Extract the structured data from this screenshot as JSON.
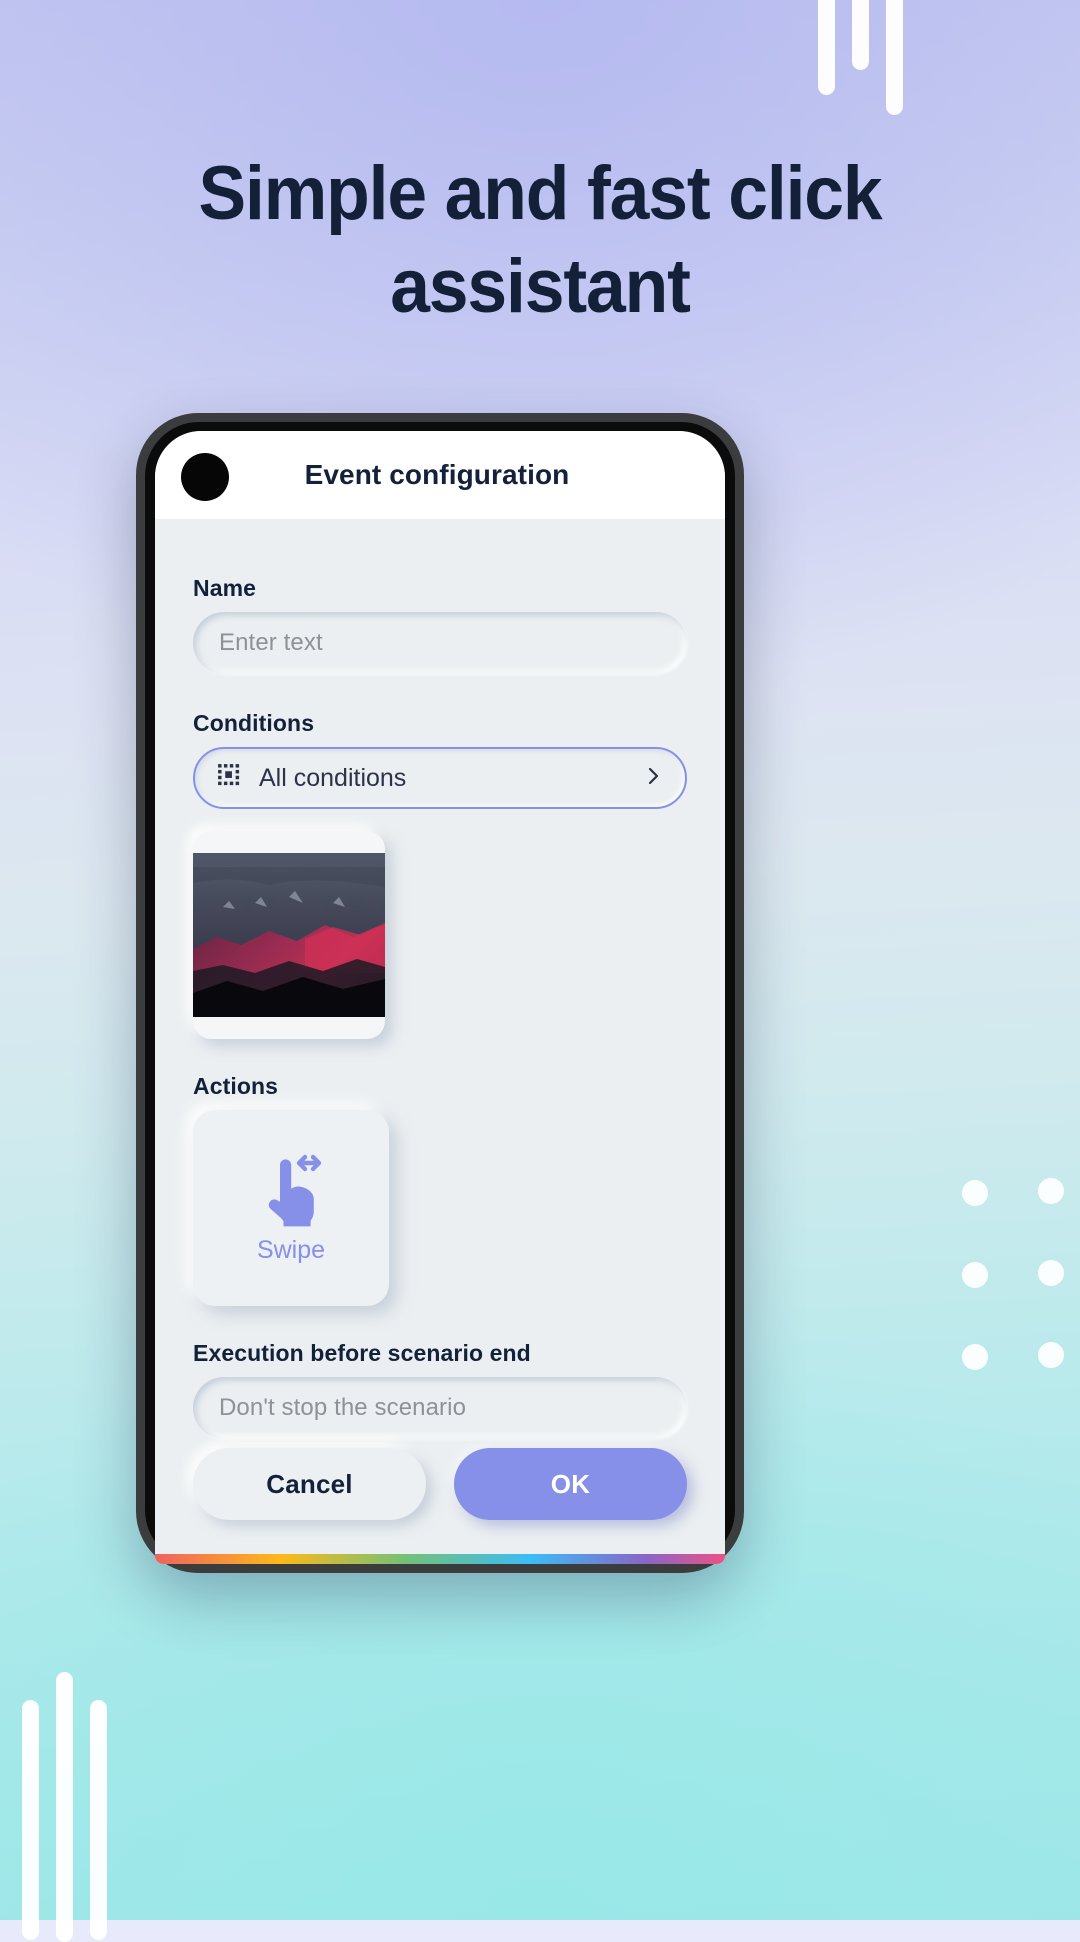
{
  "headline": {
    "line1": "Simple and fast click",
    "line2": "assistant"
  },
  "colors": {
    "accent": "#8690E8",
    "headline_text": "#132038",
    "screen_bg": "#EBEFF1",
    "label_text": "#14213A",
    "placeholder_text": "#8D9299"
  },
  "phone": {
    "appbar": {
      "title": "Event configuration",
      "camera_icon": "camera-punch-hole"
    },
    "form": {
      "name": {
        "label": "Name",
        "placeholder": "Enter text",
        "value": ""
      },
      "conditions": {
        "label": "Conditions",
        "icon": "dotted-square-icon",
        "value": "All conditions",
        "chevron_icon": "chevron-right-icon"
      },
      "condition_image": {
        "alt": "mountain-screenshot-thumbnail"
      },
      "actions": {
        "label": "Actions",
        "items": [
          {
            "icon": "swipe-hand-icon",
            "label": "Swipe"
          }
        ]
      },
      "execution": {
        "label": "Execution before scenario end",
        "value": "Don't stop the scenario"
      }
    },
    "buttons": {
      "cancel": "Cancel",
      "ok": "OK"
    }
  }
}
